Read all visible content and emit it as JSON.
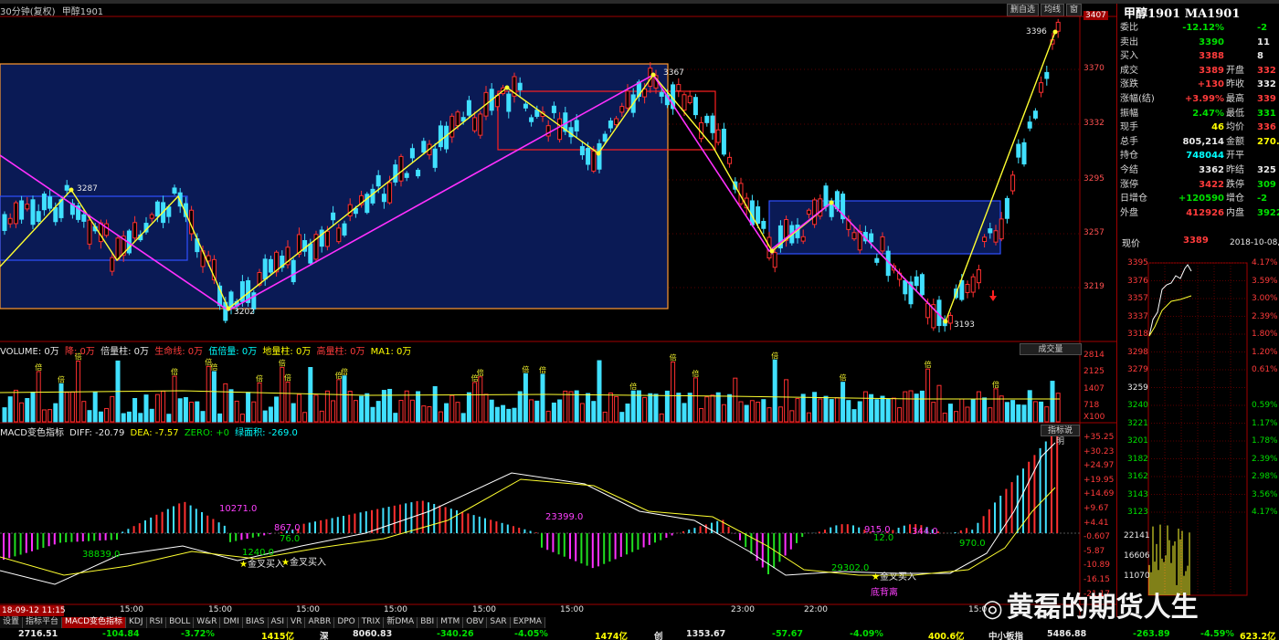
{
  "chart_title": {
    "period": "30分钟(复权)",
    "symbol": "甲醇1901"
  },
  "toolbar": {
    "btn1": "删自选",
    "btn2": "均线",
    "btn3": "窗"
  },
  "price_axis": [
    "3407",
    "3370",
    "3332",
    "3295",
    "3257",
    "3219"
  ],
  "price_labels": {
    "p3287": "3287",
    "p3202": "3202",
    "p3367": "3367",
    "p3193": "3193",
    "p3396": "3396"
  },
  "volume_legend": {
    "volume": "VOLUME: 0万",
    "down": "降: 0万",
    "times": "倍量柱: 0万",
    "life": "生命线: 0万",
    "shrink": "伍倍量: 0万",
    "base": "地量柱: 0万",
    "high": "高量柱: 0万",
    "ma": "MA1: 0万"
  },
  "volume_button": "成交量",
  "volume_axis": [
    "2814",
    "2125",
    "1407",
    "718",
    "X100"
  ],
  "macd_legend": {
    "name": "MACD变色指标",
    "diff": "DIFF: -20.79",
    "dea": "DEA: -7.57",
    "zero": "ZERO: +0",
    "area": "绿面积: -269.0"
  },
  "macd_button": "指标说明",
  "macd_axis": [
    "+35.25",
    "+30.23",
    "+24.97",
    "+19.95",
    "+14.69",
    "+9.67",
    "+4.41",
    "-0.607",
    "-5.87",
    "-10.89",
    "-16.15",
    "-21.17"
  ],
  "macd_annotations": {
    "a1": "10271.0",
    "a2": "867.0",
    "a3": "23399.0",
    "a4": "38839.0",
    "a5": "1240.0",
    "a6": "76.0",
    "a7": "金叉买入",
    "a8": "金叉买入",
    "a9": "915.0",
    "a10": "12.0",
    "a11": "344.0",
    "a12": "970.0",
    "a13": "29302.0",
    "a14": "金叉买入",
    "a15": "底背离"
  },
  "time_axis": {
    "start": "18-09-12 11:15",
    "t1": "15:00",
    "t2": "15:00",
    "t3": "15:00",
    "t4": "15:00",
    "t5": "15:00",
    "t6": "15:00",
    "t7": "23:00",
    "t8": "22:00",
    "t9": "15:0"
  },
  "tabs": [
    "设置",
    "指标平台",
    "MACD变色指标",
    "KDJ",
    "RSI",
    "BOLL",
    "W&R",
    "DMI",
    "BIAS",
    "ASI",
    "VR",
    "ARBR",
    "DPO",
    "TRIX",
    "新DMA",
    "BBI",
    "MTM",
    "OBV",
    "SAR",
    "EXPMA"
  ],
  "status": {
    "s1": "2716.51",
    "s2": "-104.84",
    "s3": "-3.72%",
    "s4": "1415亿",
    "s5": "深",
    "s6": "8060.83",
    "s7": "-340.26",
    "s8": "-4.05%",
    "s9": "1474亿",
    "s10": "创",
    "s11": "1353.67",
    "s12": "-57.67",
    "s13": "-4.09%",
    "s14": "400.6亿",
    "s15": "中小板指",
    "s16": "5486.88",
    "s17": "-263.89",
    "s18": "-4.59%",
    "s19": "623.2亿"
  },
  "right_panel": {
    "title": "甲醇1901 MA1901",
    "rows": [
      {
        "k": "委比",
        "v1": "-12.12%",
        "k2": "",
        "v2": "-2"
      },
      {
        "k": "卖出",
        "v1": "3390",
        "k2": "",
        "v2": "11"
      },
      {
        "k": "买入",
        "v1": "3388",
        "k2": "",
        "v2": "8"
      },
      {
        "k": "成交",
        "v1": "3389",
        "k2": "开盘",
        "v2": "332"
      },
      {
        "k": "涨跌",
        "v1": "+130",
        "k2": "昨收",
        "v2": "332"
      },
      {
        "k": "涨幅(结)",
        "v1": "+3.99%",
        "k2": "最高",
        "v2": "339"
      },
      {
        "k": "振幅",
        "v1": "2.47%",
        "k2": "最低",
        "v2": "331"
      },
      {
        "k": "现手",
        "v1": "46",
        "k2": "均价",
        "v2": "336"
      },
      {
        "k": "总手",
        "v1": "805,214",
        "k2": "金额",
        "v2": "270.7"
      },
      {
        "k": "持仓",
        "v1": "748044",
        "k2": "开平",
        "v2": ""
      },
      {
        "k": "今结",
        "v1": "3362",
        "k2": "昨结",
        "v2": "325"
      },
      {
        "k": "涨停",
        "v1": "3422",
        "k2": "跌停",
        "v2": "309"
      },
      {
        "k": "日增仓",
        "v1": "+120590",
        "k2": "增仓",
        "v2": "-2"
      },
      {
        "k": "外盘",
        "v1": "412926",
        "k2": "内盘",
        "v2": "39228"
      }
    ],
    "now_label": "现价",
    "now_value": "3389",
    "now_date": "2018-10-08,一",
    "mini_price_axis": [
      "3395",
      "3376",
      "3357",
      "3337",
      "3318",
      "3298",
      "3279",
      "3259",
      "3240",
      "3221",
      "3201",
      "3182",
      "3162",
      "3143",
      "3123"
    ],
    "mini_pct_axis": [
      "4.17%",
      "3.59%",
      "3.00%",
      "2.39%",
      "1.80%",
      "1.20%",
      "0.61%",
      "",
      "0.59%",
      "1.17%",
      "1.78%",
      "2.39%",
      "2.98%",
      "3.56%",
      "4.17%"
    ],
    "mini_vol_axis": [
      "22141",
      "16606",
      "11070"
    ]
  },
  "watermark": "黄磊的期货人生"
}
